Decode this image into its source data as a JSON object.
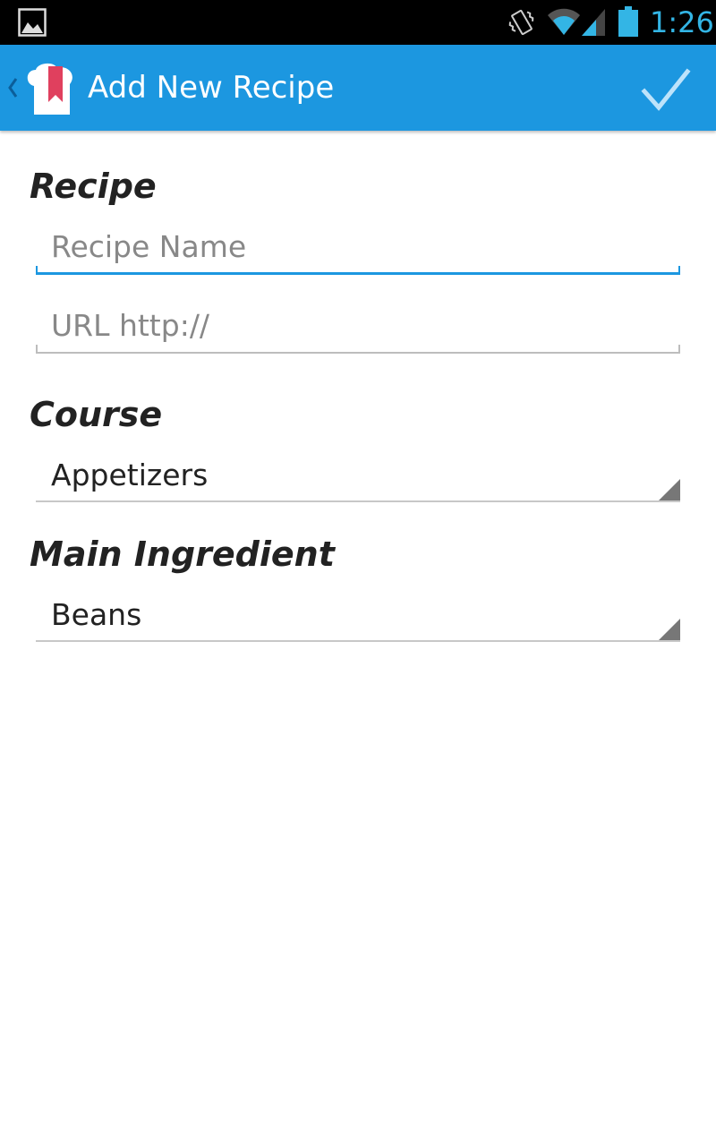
{
  "status_bar": {
    "time": "1:26",
    "icons": [
      "gallery-icon",
      "vibrate-icon",
      "wifi-icon",
      "signal-icon",
      "battery-icon"
    ],
    "accent": "#33b5e5"
  },
  "action_bar": {
    "title": "Add New Recipe",
    "background": "#1c97e0",
    "icons": [
      "back-chevron-icon",
      "chef-hat-bookmark-logo-icon",
      "checkmark-icon"
    ]
  },
  "form": {
    "recipe_heading": "Recipe",
    "recipe_name_placeholder": "Recipe Name",
    "url_placeholder": "URL http://",
    "course_heading": "Course",
    "course_selected": "Appetizers",
    "ingredient_heading": "Main Ingredient",
    "ingredient_selected": "Beans"
  }
}
